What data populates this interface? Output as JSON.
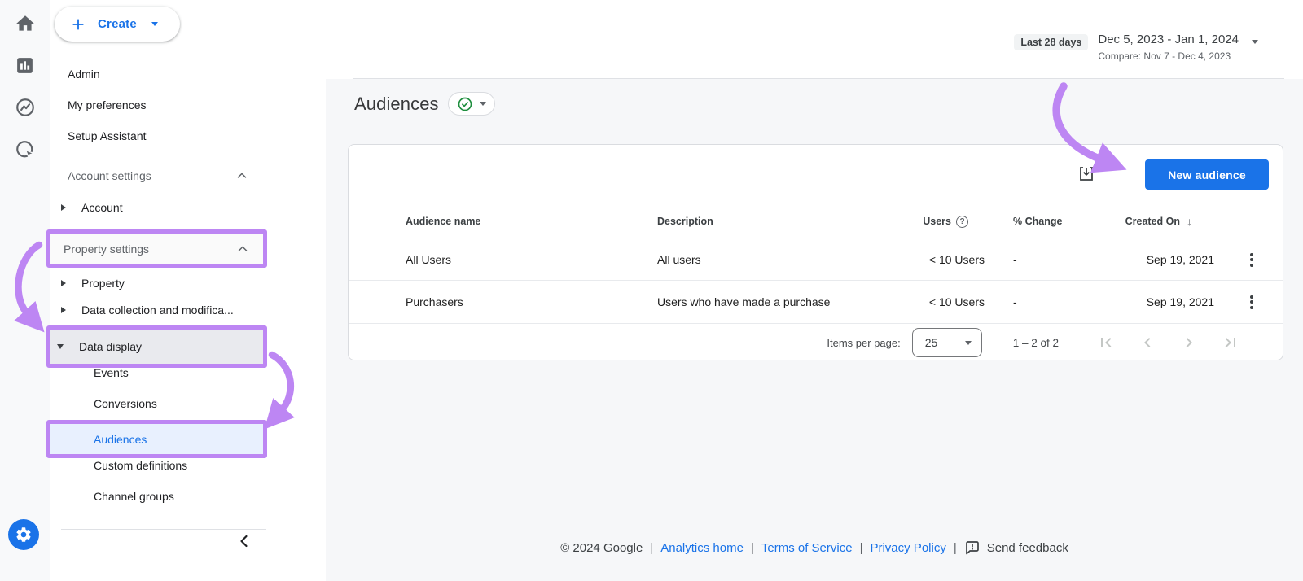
{
  "colors": {
    "accent_blue": "#1a73e8",
    "annotation_purple": "#bd86f3",
    "selected_row_bg": "#e8f0fe",
    "green_check": "#1e8e3e"
  },
  "rail": {
    "icons": [
      "home-icon",
      "reports-icon",
      "explore-icon",
      "advertising-icon"
    ],
    "admin_icon": "gear-icon"
  },
  "sidebar": {
    "create": {
      "label": "Create"
    },
    "items": [
      {
        "label": "Admin"
      },
      {
        "label": "My preferences"
      },
      {
        "label": "Setup Assistant"
      }
    ],
    "account_section": {
      "label": "Account settings"
    },
    "account_item": {
      "label": "Account"
    },
    "property_section": {
      "label": "Property settings"
    },
    "property_item": {
      "label": "Property"
    },
    "data_collection_item": {
      "label": "Data collection and modifica..."
    },
    "data_display_item": {
      "label": "Data display"
    },
    "data_display_children": [
      {
        "label": "Events"
      },
      {
        "label": "Conversions"
      },
      {
        "label": "Audiences"
      },
      {
        "label": "Custom definitions"
      },
      {
        "label": "Channel groups"
      }
    ]
  },
  "datepicker": {
    "preset": "Last 28 days",
    "range": "Dec 5, 2023 - Jan 1, 2024",
    "compare": "Compare: Nov 7 - Dec 4, 2023"
  },
  "page": {
    "title": "Audiences"
  },
  "table": {
    "new_audience_label": "New audience",
    "headers": {
      "name": "Audience name",
      "description": "Description",
      "users": "Users",
      "change": "% Change",
      "created": "Created On"
    },
    "rows": [
      {
        "name": "All Users",
        "description": "All users",
        "users": "< 10 Users",
        "change": "-",
        "created": "Sep 19, 2021"
      },
      {
        "name": "Purchasers",
        "description": "Users who have made a purchase",
        "users": "< 10 Users",
        "change": "-",
        "created": "Sep 19, 2021"
      }
    ],
    "pagination": {
      "items_per_page_label": "Items per page:",
      "page_size": "25",
      "range": "1 – 2 of 2"
    }
  },
  "footer": {
    "copyright": "© 2024 Google",
    "separator": "|",
    "links": [
      {
        "label": "Analytics home"
      },
      {
        "label": "Terms of Service"
      },
      {
        "label": "Privacy Policy"
      }
    ],
    "feedback": "Send feedback"
  }
}
